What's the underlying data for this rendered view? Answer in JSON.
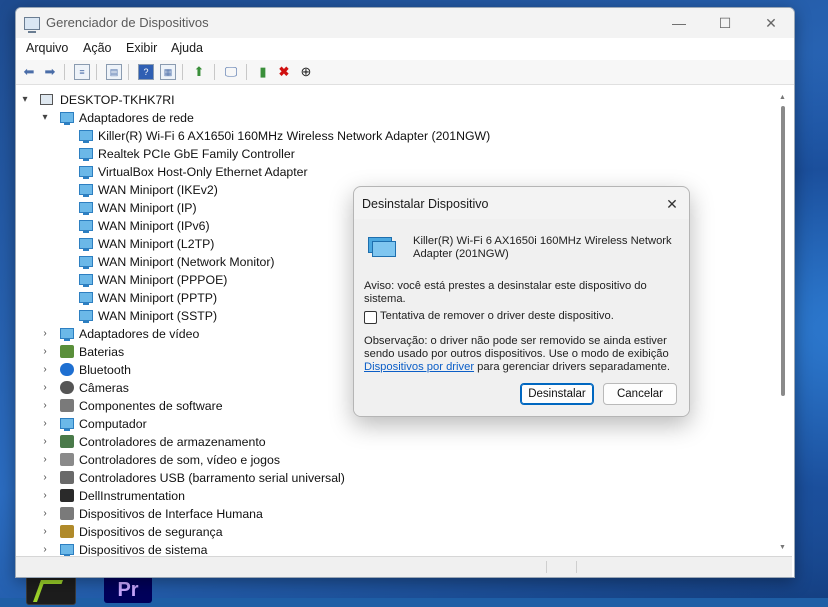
{
  "window": {
    "title": "Gerenciador de Dispositivos",
    "controls": {
      "minimize": "—",
      "maximize": "☐",
      "close": "✕"
    }
  },
  "menu": [
    "Arquivo",
    "Ação",
    "Exibir",
    "Ajuda"
  ],
  "tree": {
    "root": "DESKTOP-TKHK7RI",
    "network_category": "Adaptadores de rede",
    "network_devices": [
      "Killer(R) Wi-Fi 6 AX1650i 160MHz Wireless Network Adapter (201NGW)",
      "Realtek PCIe GbE Family Controller",
      "VirtualBox Host-Only Ethernet Adapter",
      "WAN Miniport (IKEv2)",
      "WAN Miniport (IP)",
      "WAN Miniport (IPv6)",
      "WAN Miniport (L2TP)",
      "WAN Miniport (Network Monitor)",
      "WAN Miniport (PPPOE)",
      "WAN Miniport (PPTP)",
      "WAN Miniport (SSTP)"
    ],
    "categories": [
      "Adaptadores de vídeo",
      "Baterias",
      "Bluetooth",
      "Câmeras",
      "Componentes de software",
      "Computador",
      "Controladores de armazenamento",
      "Controladores de som, vídeo e jogos",
      "Controladores USB (barramento serial universal)",
      "DellInstrumentation",
      "Dispositivos de Interface Humana",
      "Dispositivos de segurança",
      "Dispositivos de sistema"
    ]
  },
  "dialog": {
    "title": "Desinstalar Dispositivo",
    "close": "✕",
    "device_name": "Killer(R) Wi-Fi 6 AX1650i 160MHz Wireless Network Adapter (201NGW)",
    "warning": "Aviso: você está prestes a desinstalar este dispositivo do sistema.",
    "checkbox_label": "Tentativa de remover o driver deste dispositivo.",
    "checkbox_checked": false,
    "note_before": "Observação: o driver não pode ser removido se ainda estiver sendo usado por outros dispositivos. Use o modo de exibição ",
    "note_link": "Dispositivos por driver",
    "note_after": " para gerenciar drivers separadamente.",
    "uninstall_button": "Desinstalar",
    "cancel_button": "Cancelar"
  },
  "taskbar": {
    "premiere_label": "Pr"
  }
}
